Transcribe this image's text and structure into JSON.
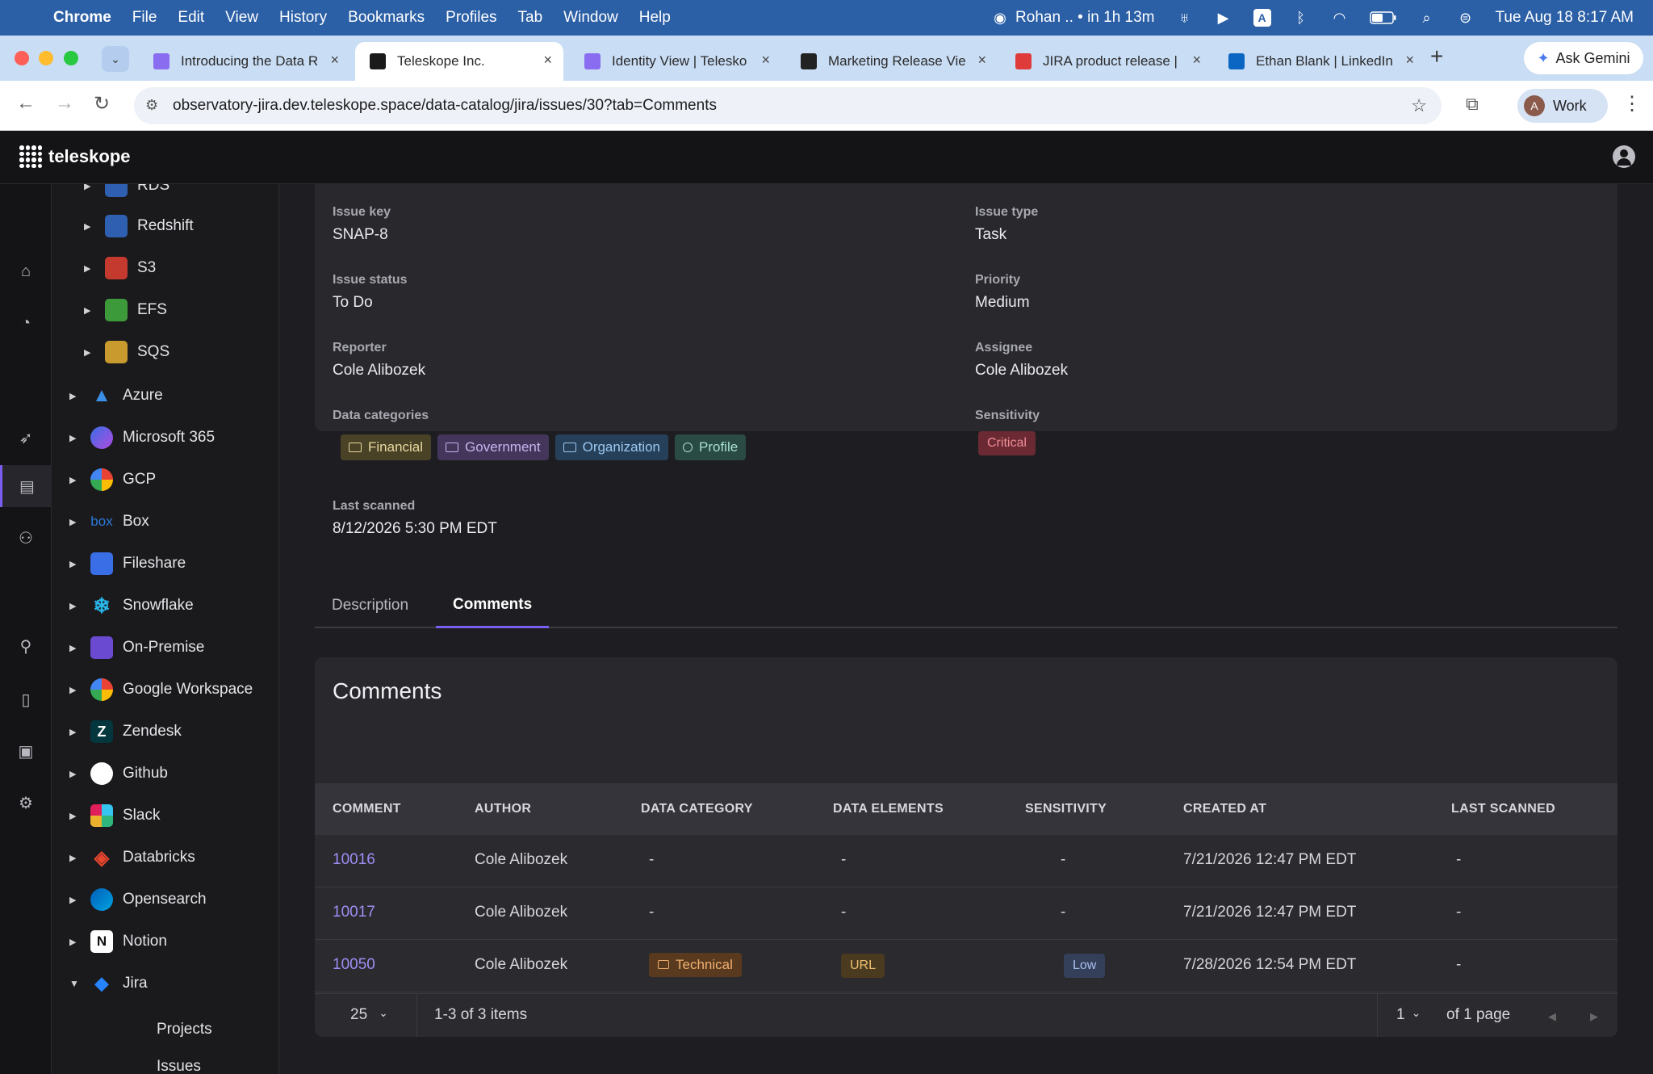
{
  "menubar": {
    "app": "Chrome",
    "items": [
      "File",
      "Edit",
      "View",
      "History",
      "Bookmarks",
      "Profiles",
      "Tab",
      "Window",
      "Help"
    ],
    "status_meeting": "Rohan .. • in 1h 13m",
    "datetime": "Tue Aug 18  8:17 AM"
  },
  "tabs": [
    {
      "title": "Introducing the Data R",
      "favicon_color": "#8a6cf0"
    },
    {
      "title": "Teleskope Inc.",
      "favicon_color": "#1a1a1a"
    },
    {
      "title": "Identity View | Telesko",
      "favicon_color": "#8a6cf0"
    },
    {
      "title": "Marketing Release Vie",
      "favicon_color": "#222222"
    },
    {
      "title": "JIRA product release |",
      "favicon_color": "#e03b3b"
    },
    {
      "title": "Ethan Blank | LinkedIn",
      "favicon_color": "#0a66c2"
    }
  ],
  "gemini_label": "Ask Gemini",
  "address": {
    "url": "observatory-jira.dev.teleskope.space/data-catalog/jira/issues/30?tab=Comments",
    "profile_initial": "A",
    "profile_label": "Work"
  },
  "app": {
    "brand": "teleskope"
  },
  "tree": {
    "sub_items": [
      "RDS",
      "Redshift",
      "S3",
      "EFS",
      "SQS"
    ],
    "items": [
      "Azure",
      "Microsoft 365",
      "GCP",
      "Box",
      "Fileshare",
      "Snowflake",
      "On-Premise",
      "Google Workspace",
      "Zendesk",
      "Github",
      "Slack",
      "Databricks",
      "Opensearch",
      "Notion",
      "Jira"
    ],
    "jira_children": [
      "Projects",
      "Issues"
    ],
    "box_logo_text": "box",
    "notion_logo_text": "N"
  },
  "details": {
    "issue_key_label": "Issue key",
    "issue_key": "SNAP-8",
    "issue_type_label": "Issue type",
    "issue_type": "Task",
    "status_label": "Issue status",
    "status": "To Do",
    "priority_label": "Priority",
    "priority": "Medium",
    "reporter_label": "Reporter",
    "reporter": "Cole Alibozek",
    "assignee_label": "Assignee",
    "assignee": "Cole Alibozek",
    "categories_label": "Data categories",
    "categories": [
      "Financial",
      "Government",
      "Organization",
      "Profile"
    ],
    "sensitivity_label": "Sensitivity",
    "sensitivity": "Critical",
    "last_scanned_label": "Last scanned",
    "last_scanned": "8/12/2026 5:30 PM EDT"
  },
  "page_tabs": [
    "Description",
    "Comments"
  ],
  "comments": {
    "title": "Comments",
    "columns": [
      "COMMENT",
      "AUTHOR",
      "DATA CATEGORY",
      "DATA ELEMENTS",
      "SENSITIVITY",
      "CREATED AT",
      "LAST SCANNED"
    ],
    "rows": [
      {
        "id": "10016",
        "author": "Cole Alibozek",
        "category": "-",
        "elements": "-",
        "sensitivity": "-",
        "created": "7/21/2026 12:47 PM EDT",
        "scanned": "-"
      },
      {
        "id": "10017",
        "author": "Cole Alibozek",
        "category": "-",
        "elements": "-",
        "sensitivity": "-",
        "created": "7/21/2026 12:47 PM EDT",
        "scanned": "-"
      },
      {
        "id": "10050",
        "author": "Cole Alibozek",
        "category": "Technical",
        "elements": "URL",
        "sensitivity": "Low",
        "created": "7/28/2026 12:54 PM EDT",
        "scanned": "-"
      }
    ],
    "page_size": "25",
    "range_text": "1-3 of 3 items",
    "page": "1",
    "page_total": "of 1 page"
  },
  "colors": {
    "accent": "#7b5cf0",
    "critical_bg": "#6b2a33",
    "critical_fg": "#f08c96",
    "financial_bg": "#4a4226",
    "financial_fg": "#e8d9a0",
    "government_bg": "#43365a",
    "government_fg": "#c8b3f0",
    "organization_bg": "#26405a",
    "organization_fg": "#9cc8f0",
    "profile_bg": "#2a4a44",
    "profile_fg": "#a8e0d0",
    "technical_bg": "#5a3a1e",
    "technical_fg": "#f0b070",
    "url_bg": "#4a3a20",
    "url_fg": "#f0c070",
    "low_bg": "#34405a",
    "low_fg": "#a8c0ec"
  }
}
